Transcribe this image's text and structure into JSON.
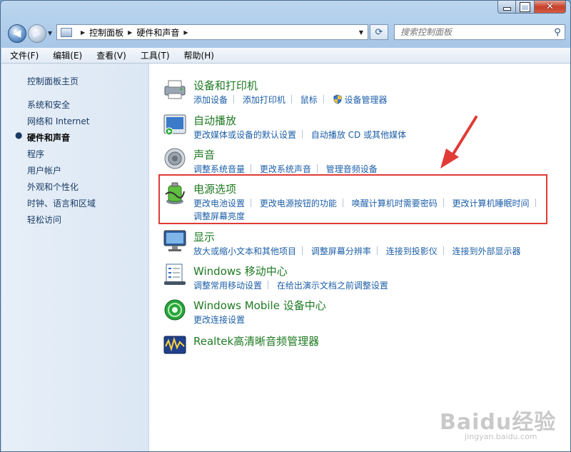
{
  "window": {
    "controls": {
      "minimize": "—",
      "maximize": "□",
      "close": "✕"
    }
  },
  "navigation": {
    "breadcrumb": [
      "控制面板",
      "硬件和声音"
    ],
    "search_placeholder": "搜索控制面板"
  },
  "menu": [
    "文件(F)",
    "编辑(E)",
    "查看(V)",
    "工具(T)",
    "帮助(H)"
  ],
  "sidebar": {
    "home": "控制面板主页",
    "items": [
      "系统和安全",
      "网络和 Internet",
      "硬件和声音",
      "程序",
      "用户帐户",
      "外观和个性化",
      "时钟、语言和区域",
      "轻松访问"
    ],
    "current_index": 2
  },
  "categories": [
    {
      "title": "设备和打印机",
      "icon": "printer-icon",
      "links": [
        "添加设备",
        "添加打印机",
        "鼠标",
        "设备管理器"
      ]
    },
    {
      "title": "自动播放",
      "icon": "autoplay-icon",
      "links": [
        "更改媒体或设备的默认设置",
        "自动播放 CD 或其他媒体"
      ]
    },
    {
      "title": "声音",
      "icon": "speaker-icon",
      "links": [
        "调整系统音量",
        "更改系统声音",
        "管理音频设备"
      ]
    },
    {
      "title": "电源选项",
      "icon": "battery-icon",
      "links": [
        "更改电池设置",
        "更改电源按钮的功能",
        "唤醒计算机时需要密码",
        "更改计算机睡眠时间",
        "调整屏幕亮度"
      ]
    },
    {
      "title": "显示",
      "icon": "monitor-icon",
      "links": [
        "放大或缩小文本和其他项目",
        "调整屏幕分辨率",
        "连接到投影仪",
        "连接到外部显示器"
      ]
    },
    {
      "title": "Windows 移动中心",
      "icon": "mobility-center-icon",
      "links": [
        "调整常用移动设置",
        "在给出演示文档之前调整设置"
      ]
    },
    {
      "title": "Windows Mobile 设备中心",
      "icon": "mobile-device-center-icon",
      "links": [
        "更改连接设置"
      ]
    },
    {
      "title": "Realtek高清晰音频管理器",
      "icon": "realtek-audio-icon",
      "links": []
    }
  ],
  "watermark": {
    "main": "Baidu经验",
    "sub": "jingyan.baidu.com"
  },
  "colors": {
    "title_green": "#1e7a22",
    "link_blue": "#1d5fa8",
    "highlight_red": "#e13b36"
  }
}
